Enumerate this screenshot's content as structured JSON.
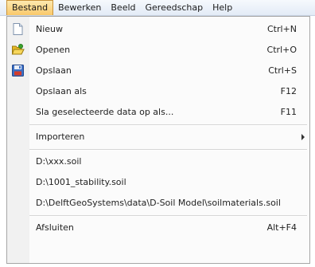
{
  "menubar": {
    "items": [
      {
        "label": "Bestand",
        "active": true
      },
      {
        "label": "Bewerken"
      },
      {
        "label": "Beeld"
      },
      {
        "label": "Gereedschap"
      },
      {
        "label": "Help"
      }
    ]
  },
  "menu": {
    "new": {
      "label": "Nieuw",
      "shortcut": "Ctrl+N",
      "icon": "new-document-icon"
    },
    "open": {
      "label": "Openen",
      "shortcut": "Ctrl+O",
      "icon": "open-folder-icon"
    },
    "save": {
      "label": "Opslaan",
      "shortcut": "Ctrl+S",
      "icon": "save-disk-icon"
    },
    "save_as": {
      "label": "Opslaan als",
      "shortcut": "F12"
    },
    "save_selected": {
      "label": "Sla geselecteerde data op als...",
      "shortcut": "F11"
    },
    "import": {
      "label": "Importeren",
      "submenu_icon": "chevron-right-icon"
    },
    "recent": [
      {
        "label": "D:\\xxx.soil"
      },
      {
        "label": "D:\\1001_stability.soil"
      },
      {
        "label": "D:\\DelftGeoSystems\\data\\D-Soil Model\\soilmaterials.soil"
      }
    ],
    "exit": {
      "label": "Afsluiten",
      "shortcut": "Alt+F4"
    }
  },
  "colors": {
    "active_menu": "#f9c86a",
    "menubar_bg": "#e3ebf6",
    "gutter": "#f1f1f1",
    "dropdown_bg": "#fbfbfb"
  }
}
